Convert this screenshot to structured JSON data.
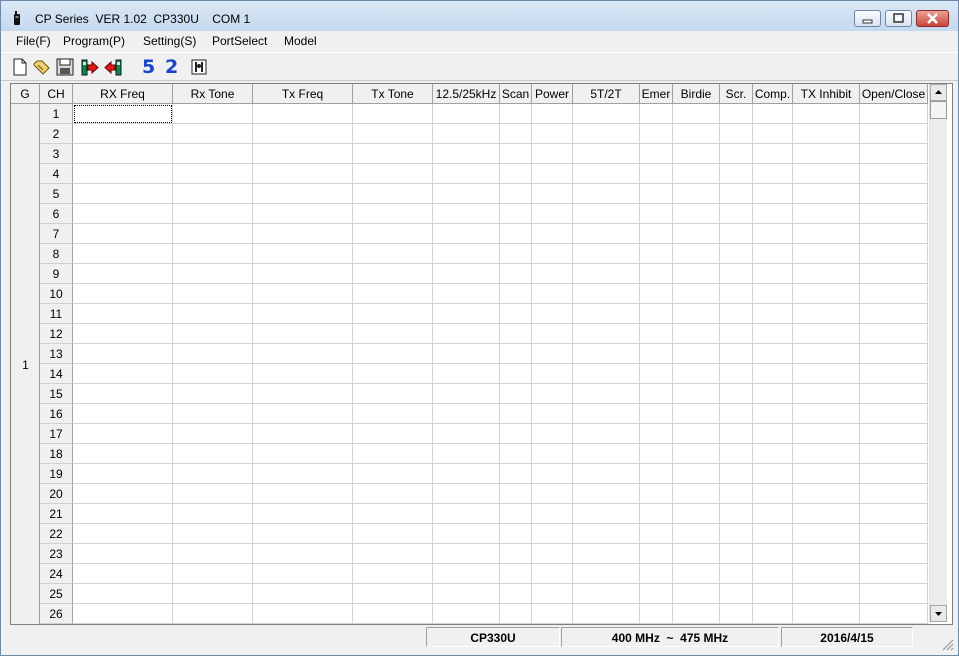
{
  "window": {
    "title": "CP Series  VER 1.02  CP330U    COM 1",
    "icon": "radio-icon"
  },
  "menu": [
    {
      "label": "File(F)"
    },
    {
      "label": "Program(P)"
    },
    {
      "label": "Setting(S)"
    },
    {
      "label": "PortSelect"
    },
    {
      "label": "Model"
    }
  ],
  "toolbar": {
    "icons": [
      "new-file-icon",
      "open-folder-icon",
      "save-disk-icon",
      "read-from-radio-icon",
      "write-to-radio-icon"
    ],
    "num1": "5",
    "num2": "2",
    "extra_icon": "tools-icon"
  },
  "table": {
    "columns": [
      "G",
      "CH",
      "RX Freq",
      "Rx Tone",
      "Tx Freq",
      "Tx Tone",
      "12.5/25kHz",
      "Scan",
      "Power",
      "5T/2T",
      "Emer",
      "Birdie",
      "Scr.",
      "Comp.",
      "TX Inhibit",
      "Open/Close"
    ],
    "group": "1",
    "channels": [
      "1",
      "2",
      "3",
      "4",
      "5",
      "6",
      "7",
      "8",
      "9",
      "10",
      "11",
      "12",
      "13",
      "14",
      "15",
      "16",
      "17",
      "18",
      "19",
      "20",
      "21",
      "22",
      "23",
      "24",
      "25",
      "26"
    ]
  },
  "status": {
    "model": "CP330U",
    "range": "400 MHz  ~  475 MHz",
    "date": "2016/4/15"
  },
  "colors": {
    "number_icon": "#1a45c7",
    "title_gradient": "#c5d8ee",
    "close_button": "#c9463d"
  }
}
